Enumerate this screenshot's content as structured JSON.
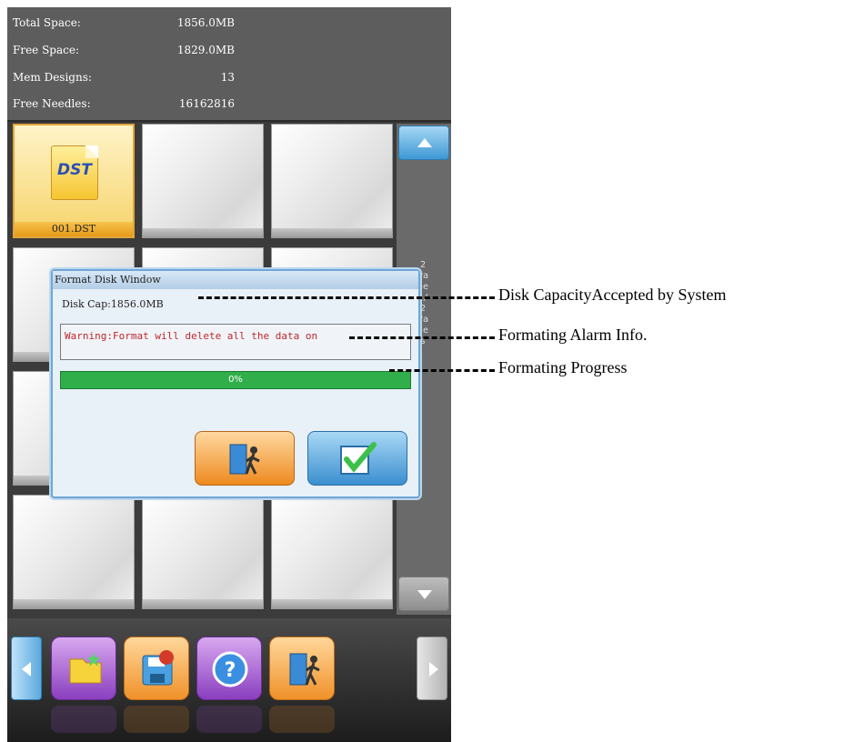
{
  "info_panel": {
    "total_space_label": "Total Space:",
    "total_space_value": "1856.0MB",
    "free_space_label": "Free Space:",
    "free_space_value": "1829.0MB",
    "mem_designs_label": "Mem Designs:",
    "mem_designs_value": "13",
    "free_needles_label": "Free Needles:",
    "free_needles_value": "16162816"
  },
  "file_grid": {
    "selected_file": {
      "type": "DST",
      "name": "001.DST"
    }
  },
  "scroll": {
    "up_icon": "triangle-up-icon",
    "down_icon": "triangle-down-icon",
    "page_indicator": "2 Pages/2 Pages"
  },
  "dialog": {
    "title": "Format Disk Window",
    "disk_cap": "Disk Cap:1856.0MB",
    "warning": "Warning:Format will delete all the data on",
    "progress_text": "0%",
    "progress_value": 0,
    "exit_icon": "exit-door-icon",
    "confirm_icon": "checkmark-icon"
  },
  "toolbar": {
    "left_arrow_icon": "arrow-left-icon",
    "new_folder_icon": "new-folder-icon",
    "disk_icon": "disk-format-icon",
    "help_icon": "help-icon",
    "exit_icon": "exit-door-icon",
    "right_arrow_icon": "arrow-right-icon"
  },
  "annotations": {
    "disk_capacity": "Disk CapacityAccepted by System",
    "alarm_info": "Formating Alarm Info.",
    "progress": "Formating Progress"
  },
  "colors": {
    "warning_text": "#c0272d",
    "progress_green": "#2fae4a",
    "accent_blue": "#3d98d4",
    "accent_orange": "#f0912a"
  }
}
